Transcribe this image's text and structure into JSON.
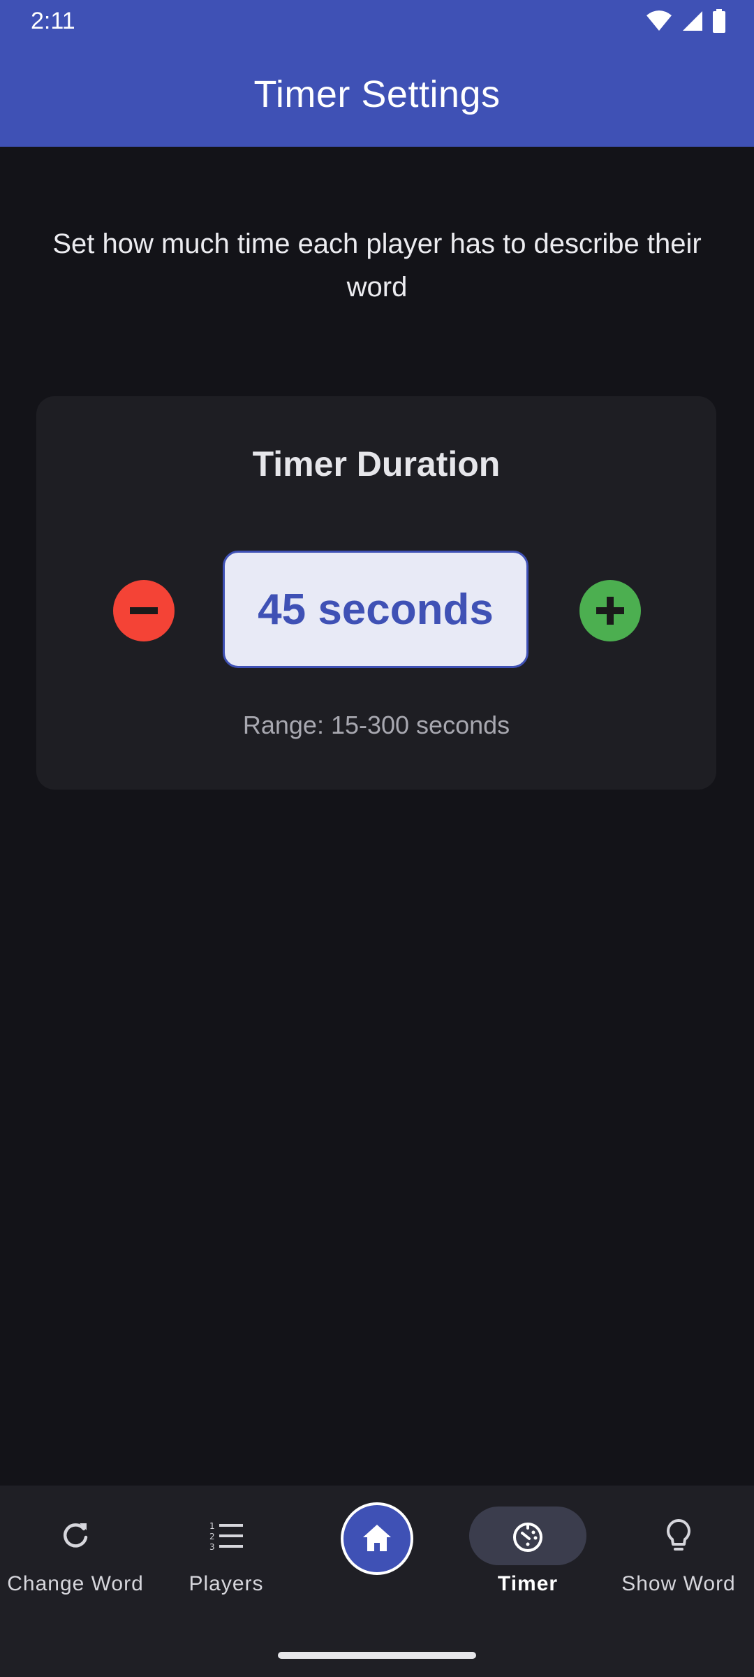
{
  "status_bar": {
    "time": "2:11",
    "icons": [
      "wifi-icon",
      "signal-icon",
      "battery-icon"
    ]
  },
  "app_bar": {
    "title": "Timer Settings",
    "color": "#3f51b5"
  },
  "description": "Set how much time each player has to describe their word",
  "timer_card": {
    "title": "Timer Duration",
    "value": "45 seconds",
    "range": "Range: 15-300 seconds",
    "decrease_color": "#f44336",
    "increase_color": "#4caf50"
  },
  "bottom_nav": {
    "items": [
      {
        "label": "Change Word",
        "icon": "refresh-icon"
      },
      {
        "label": "Players",
        "icon": "numbered-list-icon"
      },
      {
        "label": "",
        "icon": "home-icon"
      },
      {
        "label": "Timer",
        "icon": "timer-icon",
        "active": true
      },
      {
        "label": "Show Word",
        "icon": "lightbulb-icon"
      }
    ]
  }
}
